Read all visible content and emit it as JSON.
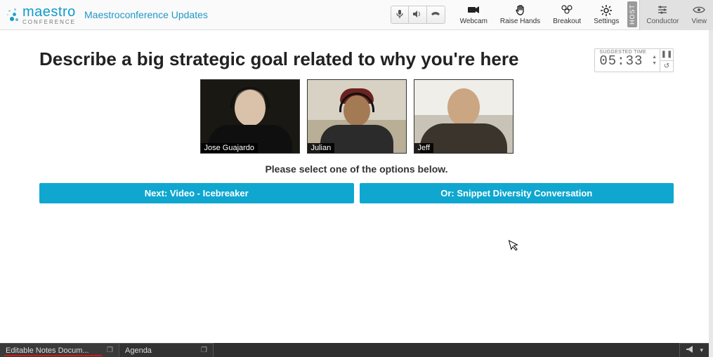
{
  "header": {
    "brand_main": "maestro",
    "brand_sub": "CONFERENCE",
    "page_title": "Maestroconference Updates",
    "actions": {
      "webcam": "Webcam",
      "raise_hands": "Raise Hands",
      "breakout": "Breakout",
      "settings": "Settings",
      "host_badge": "HOST",
      "conductor": "Conductor",
      "view": "View"
    }
  },
  "prompt": {
    "title": "Describe a big strategic goal related to why you're here",
    "timer_label": "SUGGESTED TIME",
    "timer_value": "05:33"
  },
  "participants": [
    {
      "name": "Jose Guajardo"
    },
    {
      "name": "Julian"
    },
    {
      "name": "Jeff"
    }
  ],
  "labels": {
    "select_prompt": "Please select one of the options below.",
    "next_btn": "Next: Video - Icebreaker",
    "or_btn": "Or: Snippet Diversity Conversation"
  },
  "bottom": {
    "tab1": "Editable Notes Docum...",
    "tab2": "Agenda"
  },
  "icons": {
    "mic": "mic-icon",
    "speaker": "speaker-icon",
    "phone": "phone-icon",
    "webcam": "webcam-icon",
    "raise_hand": "raise-hand-icon",
    "breakout": "breakout-icon",
    "settings": "gear-icon",
    "conductor": "sliders-icon",
    "view": "eye-icon",
    "pause": "pause-icon",
    "reset": "reset-icon",
    "megaphone": "megaphone-icon",
    "chevron_down": "chevron-down-icon",
    "window": "window-icon"
  }
}
